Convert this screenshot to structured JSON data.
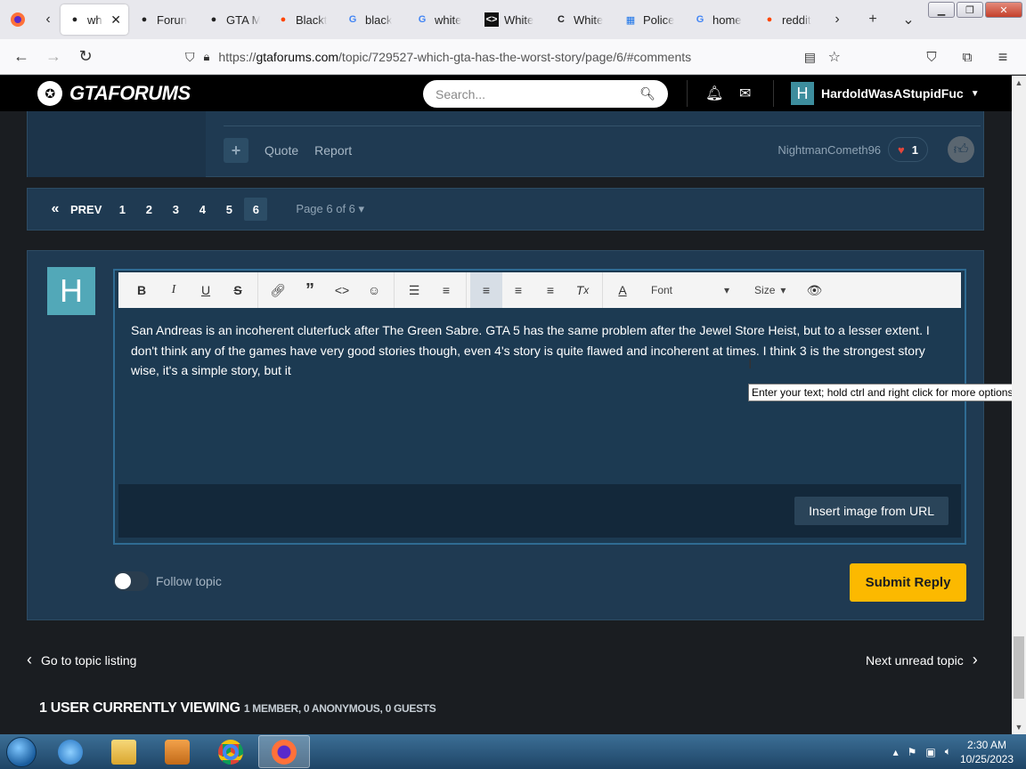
{
  "browser": {
    "tabs": [
      {
        "title": "wh",
        "fav": "gta-icon",
        "active": true
      },
      {
        "title": "Forun",
        "fav": "gta-icon"
      },
      {
        "title": "GTA M",
        "fav": "gta-icon"
      },
      {
        "title": "Blackt",
        "fav": "reddit-icon"
      },
      {
        "title": "black",
        "fav": "google-icon"
      },
      {
        "title": "white",
        "fav": "google-icon"
      },
      {
        "title": "White",
        "fav": "code-icon"
      },
      {
        "title": "White",
        "fav": "c-icon"
      },
      {
        "title": "Police",
        "fav": "calendar-icon"
      },
      {
        "title": "home",
        "fav": "google-icon"
      },
      {
        "title": "reddit",
        "fav": "reddit-icon"
      }
    ],
    "url_prefix": "https://",
    "url_domain": "gtaforums.com",
    "url_path": "/topic/729527-which-gta-has-the-worst-story/page/6/#comments"
  },
  "header": {
    "logo_text": "GTAFORUMS",
    "search_placeholder": "Search...",
    "username": "HardoldWasAStupidFuc",
    "user_initial": "H"
  },
  "post": {
    "quote_label": "Quote",
    "report_label": "Report",
    "author": "NightmanCometh96",
    "reaction_count": "1"
  },
  "pagination": {
    "first": "«",
    "prev": "PREV",
    "pages": [
      "1",
      "2",
      "3",
      "4",
      "5",
      "6"
    ],
    "current": "6",
    "page_of": "Page 6 of 6"
  },
  "editor": {
    "avatar_initial": "H",
    "font_label": "Font",
    "size_label": "Size",
    "text": "San Andreas is an incoherent cluterfuck after The Green Sabre. GTA 5 has the same problem after the Jewel Store Heist, but to a lesser extent. I don't think any of the games have very good stories though, even 4's story is quite flawed and incoherent at times. I think 3 is the strongest story wise, it's a simple story, but it",
    "insert_image_label": "Insert image from URL",
    "tooltip": "Enter your text; hold ctrl and right click for more options"
  },
  "follow_label": "Follow topic",
  "submit_label": "Submit Reply",
  "bottom_nav": {
    "back": "Go to topic listing",
    "next": "Next unread topic"
  },
  "viewing": {
    "main": "1 USER CURRENTLY VIEWING",
    "detail": "1 MEMBER, 0 ANONYMOUS, 0 GUESTS"
  },
  "taskbar": {
    "time": "2:30 AM",
    "date": "10/25/2023"
  },
  "colors": {
    "accent": "#fcb900",
    "panel": "#1f3a52",
    "avatar": "#52a8b8"
  }
}
